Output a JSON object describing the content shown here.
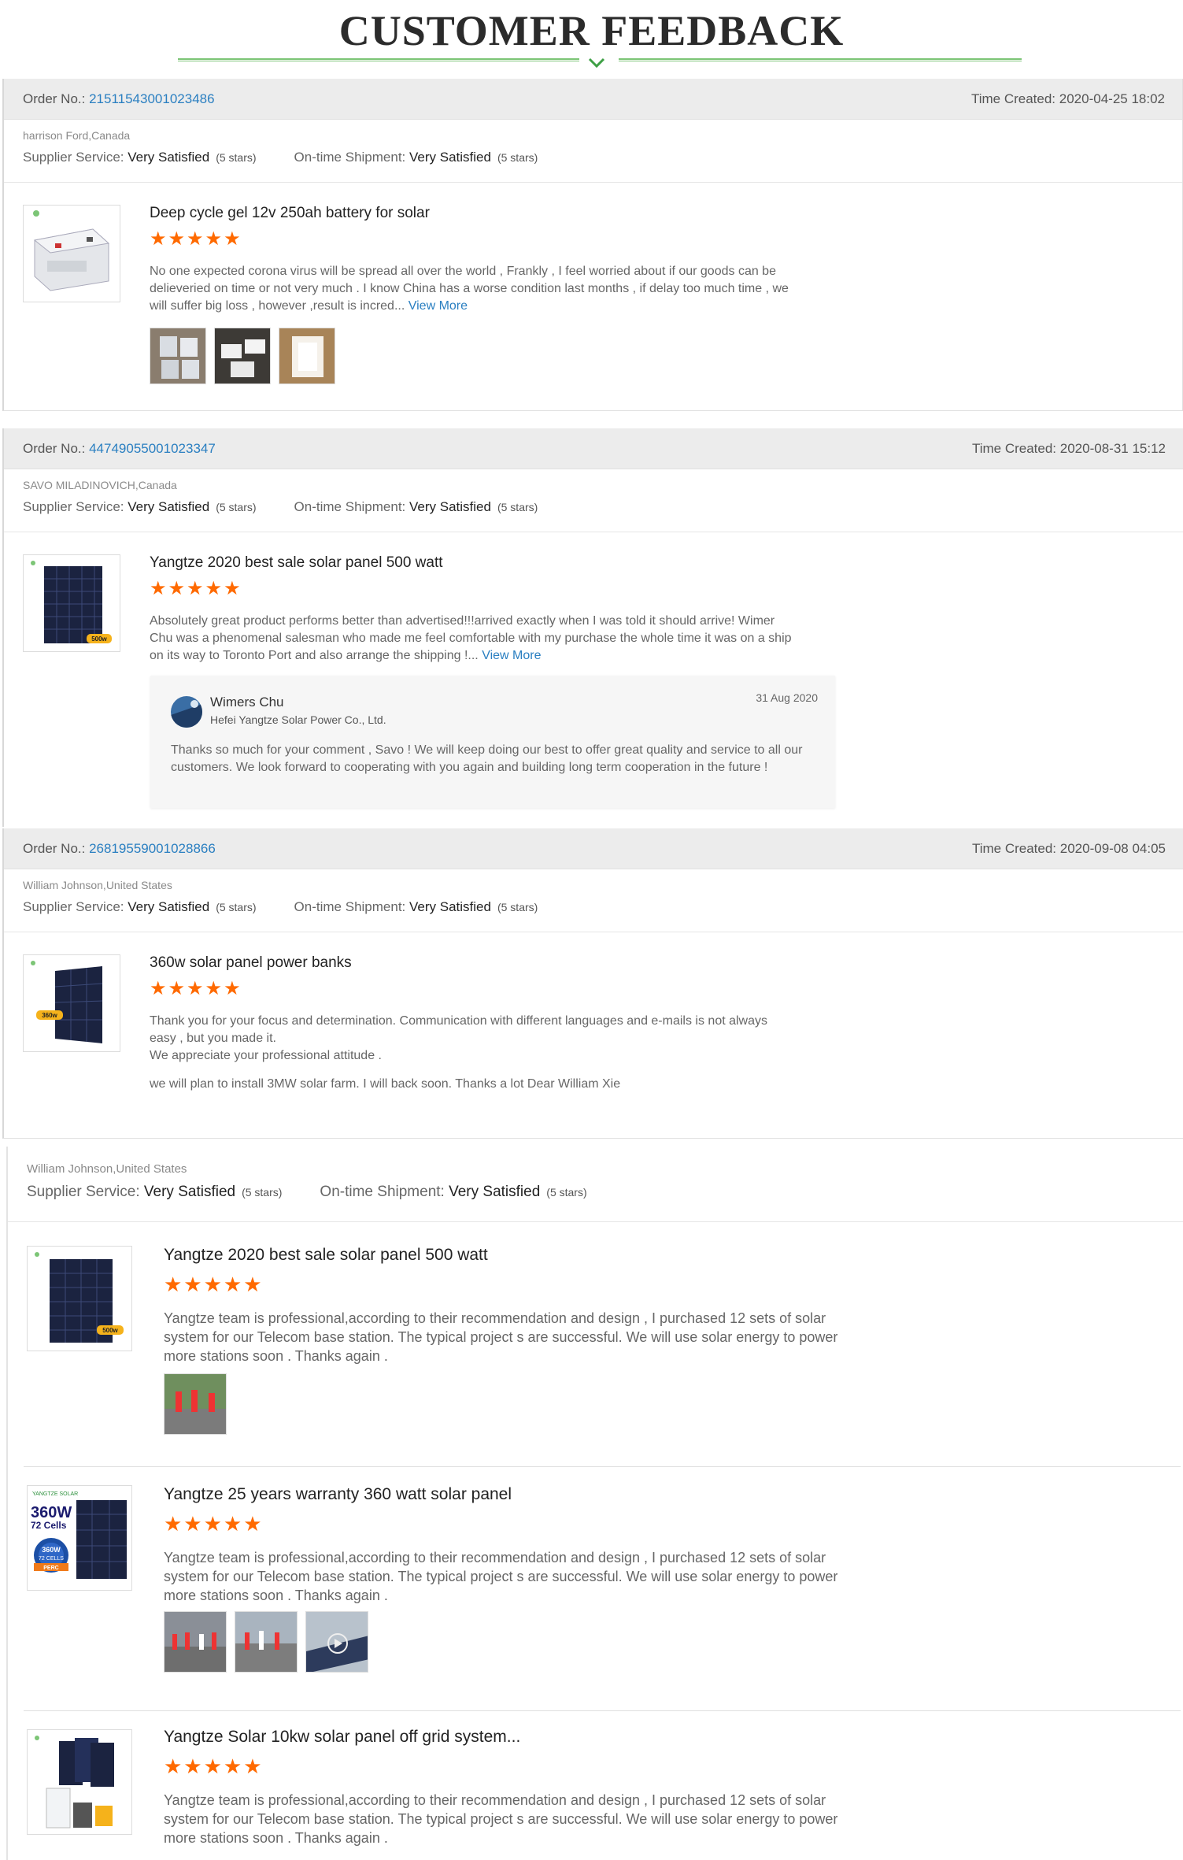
{
  "header": {
    "title": "CUSTOMER FEEDBACK"
  },
  "labels": {
    "order_no": "Order No.:",
    "time_created": "Time Created:",
    "supplier_service": "Supplier Service:",
    "ontime_shipment": "On-time Shipment:",
    "view_more": "View More"
  },
  "colors": {
    "accent_green": "#7cc576",
    "link_blue": "#2a7fc1",
    "star_orange": "#ff6a00"
  },
  "orders": [
    {
      "order_no": "21511543001023486",
      "time_created": "2020-04-25 18:02",
      "buyer": "harrison Ford,Canada",
      "supplier_rating": "Very Satisfied",
      "supplier_stars": "(5 stars)",
      "shipment_rating": "Very Satisfied",
      "shipment_stars": "(5 stars)",
      "product": {
        "name": "Deep cycle gel 12v 250ah battery for solar",
        "stars": "★★★★★",
        "review": "No one expected corona virus will be spread all over the world , Frankly , I feel worried about if our goods can be delieveried on time or not very much .  I know China has a worse condition last months , if delay too much time , we will suffer big loss , however ,result is incred...",
        "photos_icon": [
          "boxes-photo",
          "battery-photo",
          "battery-packed-photo"
        ]
      }
    },
    {
      "order_no": "44749055001023347",
      "time_created": "2020-08-31 15:12",
      "buyer": "SAVO MILADINOVICH,Canada",
      "supplier_rating": "Very Satisfied",
      "supplier_stars": "(5 stars)",
      "shipment_rating": "Very Satisfied",
      "shipment_stars": "(5 stars)",
      "product": {
        "name": "Yangtze 2020 best sale solar panel 500 watt",
        "stars": "★★★★★",
        "review": "Absolutely great product performs better than advertised!!!arrived exactly when I was told it should arrive! Wimer Chu was a phenomenal salesman who made me feel comfortable with my purchase the whole time it was on a ship on its way to Toronto Port and also arrange the shipping !..."
      },
      "reply": {
        "name": "Wimers Chu",
        "company": "Hefei Yangtze Solar Power Co., Ltd.",
        "date": "31 Aug 2020",
        "text": "Thanks so much for your comment , Savo !  We will keep doing our best to offer great quality and service to all our customers. We look forward to cooperating with you again  and  building long term cooperation in the future  !"
      }
    },
    {
      "order_no": "26819559001028866",
      "time_created": "2020-09-08 04:05",
      "buyer": "William Johnson,United States",
      "supplier_rating": "Very Satisfied",
      "supplier_stars": "(5 stars)",
      "shipment_rating": "Very Satisfied",
      "shipment_stars": "(5 stars)",
      "product": {
        "name": "360w solar panel power banks",
        "stars": "★★★★★",
        "review_lines": [
          "Thank you for your focus and determination. Communication with different languages and e-mails is not always easy , but you made it.",
          "We appreciate your professional attitude .",
          "we will plan to install 3MW solar farm. I will back soon. Thanks a lot Dear William Xie"
        ]
      }
    }
  ],
  "fourth": {
    "buyer": "William Johnson,United States",
    "supplier_rating": "Very Satisfied",
    "supplier_stars": "(5 stars)",
    "shipment_rating": "Very Satisfied",
    "shipment_stars": "(5 stars)",
    "products": [
      {
        "name": "Yangtze 2020 best sale solar panel 500 watt",
        "stars": "★★★★★",
        "review": "Yangtze team is professional,according to their recommendation and design , I purchased 12 sets of solar system for our Telecom base station. The typical project  s are successful. We will use solar energy to power more stations soon . Thanks again ."
      },
      {
        "name": "Yangtze 25 years warranty 360 watt solar panel",
        "stars": "★★★★★",
        "review": "Yangtze team is professional,according to their recommendation and design , I purchased 12 sets of solar system for our Telecom base station. The typical project  s are successful. We will use solar energy to power more stations soon . Thanks again ."
      },
      {
        "name": "Yangtze Solar 10kw solar panel off grid system...",
        "stars": "★★★★★",
        "review": "Yangtze team is professional,according to their recommendation and design , I purchased 12 sets of solar system for our Telecom base station. The typical project  s are successful. We will use solar energy to power more stations soon . Thanks again ."
      }
    ],
    "thumb_text": {
      "watt": "500w",
      "big_watt": "360W",
      "cells": "72 Cells",
      "badge_w": "360W",
      "badge_cells": "72 CELLS",
      "badge_perc": "PERC",
      "small_watt": "360w"
    }
  }
}
